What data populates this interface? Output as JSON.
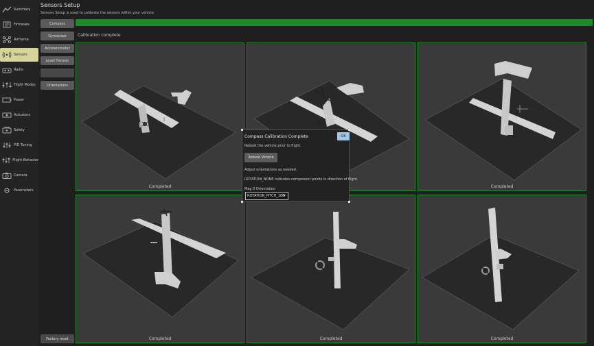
{
  "sidebar": {
    "items": [
      {
        "label": "Summary",
        "icon": "summary-icon",
        "active": false
      },
      {
        "label": "Firmware",
        "icon": "firmware-icon",
        "active": false
      },
      {
        "label": "Airframe",
        "icon": "airframe-icon",
        "active": false
      },
      {
        "label": "Sensors",
        "icon": "sensors-icon",
        "active": true
      },
      {
        "label": "Radio",
        "icon": "radio-icon",
        "active": false
      },
      {
        "label": "Flight Modes",
        "icon": "flight-modes-icon",
        "active": false
      },
      {
        "label": "Power",
        "icon": "power-icon",
        "active": false
      },
      {
        "label": "Actuators",
        "icon": "actuators-icon",
        "active": false
      },
      {
        "label": "Safety",
        "icon": "safety-icon",
        "active": false
      },
      {
        "label": "PID Tuning",
        "icon": "pid-tuning-icon",
        "active": false
      },
      {
        "label": "Flight Behavior",
        "icon": "flight-behavior-icon",
        "active": false
      },
      {
        "label": "Camera",
        "icon": "camera-icon",
        "active": false
      },
      {
        "label": "Parameters",
        "icon": "parameters-icon",
        "active": false
      }
    ]
  },
  "sensors_menu": {
    "items": [
      "Compass",
      "Gyroscope",
      "Accelerometer",
      "Level Horizon",
      "Orientations"
    ],
    "disabled_button": "",
    "factory_reset": "Factory reset"
  },
  "header": {
    "title": "Sensors Setup",
    "subtitle": "Sensors Setup is used to calibrate the sensors within your vehicle."
  },
  "progress": {
    "fraction": 1.0,
    "color": "#1f8a29"
  },
  "calibration": {
    "status": "Calibration complete",
    "cells": [
      {
        "label": "Completed"
      },
      {
        "label": ""
      },
      {
        "label": "Completed"
      },
      {
        "label": "Completed"
      },
      {
        "label": "Completed"
      },
      {
        "label": "Completed"
      }
    ]
  },
  "dialog": {
    "title": "Compass Calibration Complete",
    "ok": "OK",
    "reboot_msg": "Reboot the vehicle prior to flight.",
    "reboot_button": "Reboot Vehicle",
    "adjust_msg": "Adjust orientations as needed.",
    "rotation_note": "ROTATION_NONE indicates component points in direction of flight.",
    "mag_label": "Mag 0 Orientation",
    "mag_value": "ROTATION_PITCH_180"
  },
  "colors": {
    "accent": "#d7d49a",
    "progress": "#1f8a29",
    "ok_button": "#9fc8e4"
  }
}
